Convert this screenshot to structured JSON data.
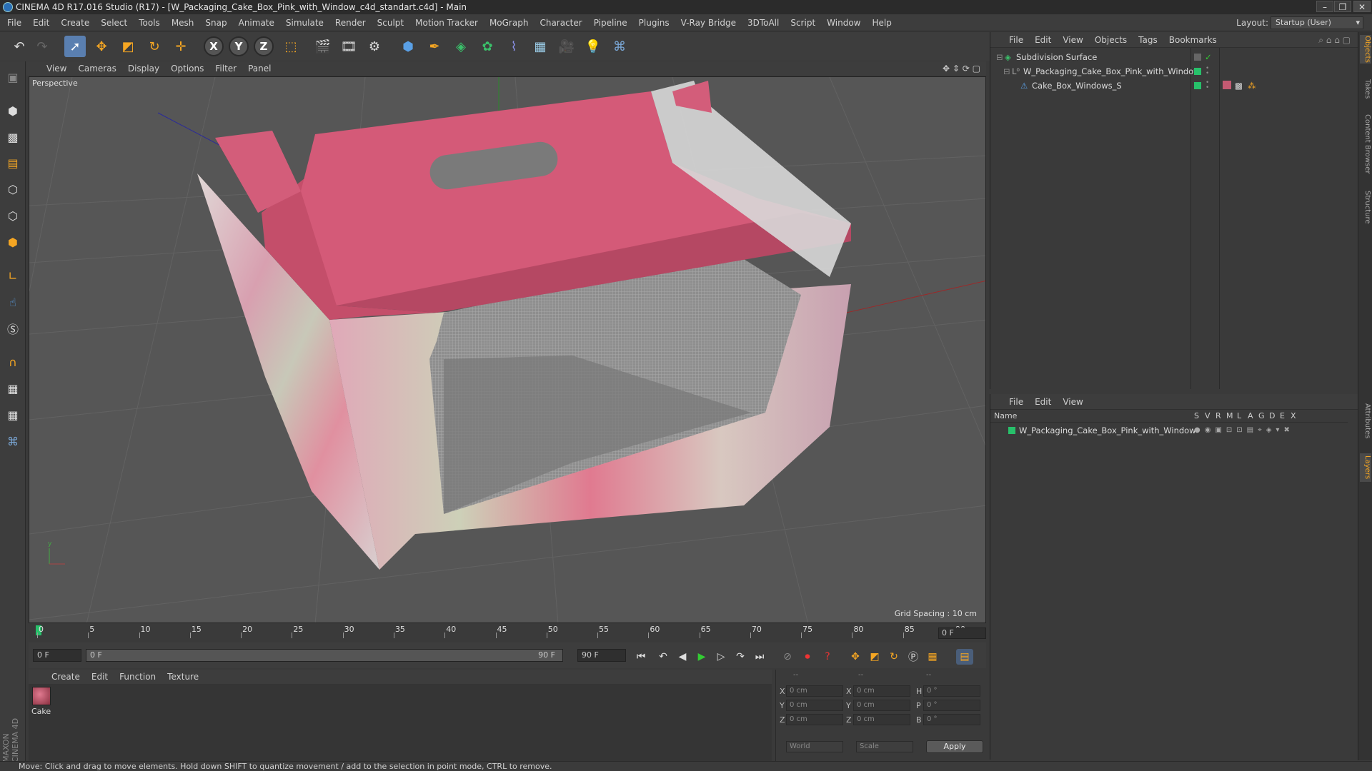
{
  "window": {
    "title": "CINEMA 4D R17.016 Studio (R17) - [W_Packaging_Cake_Box_Pink_with_Window_c4d_standart.c4d] - Main",
    "buttons": [
      "–",
      "❐",
      "✕"
    ]
  },
  "menubar": {
    "items": [
      "File",
      "Edit",
      "Create",
      "Select",
      "Tools",
      "Mesh",
      "Snap",
      "Animate",
      "Simulate",
      "Render",
      "Sculpt",
      "Motion Tracker",
      "MoGraph",
      "Character",
      "Pipeline",
      "Plugins",
      "V-Ray Bridge",
      "3DToAll",
      "Script",
      "Window",
      "Help"
    ],
    "layout_label": "Layout:",
    "layout_value": "Startup (User)"
  },
  "toolbar": {
    "axis_x": "X",
    "axis_y": "Y",
    "axis_z": "Z"
  },
  "viewport": {
    "menu": [
      "View",
      "Cameras",
      "Display",
      "Options",
      "Filter",
      "Panel"
    ],
    "label": "Perspective",
    "grid_spacing": "Grid Spacing : 10 cm",
    "colors": {
      "box_pink": "#c4526d",
      "box_lid": "#d45a78",
      "background": "#565656"
    }
  },
  "timeline": {
    "ticks": [
      "0",
      "5",
      "10",
      "15",
      "20",
      "25",
      "30",
      "35",
      "40",
      "45",
      "50",
      "55",
      "60",
      "65",
      "70",
      "75",
      "80",
      "85",
      "90"
    ],
    "current_frame": "0 F",
    "start_field": "0 F",
    "range_start": "0 F",
    "range_end": "90 F",
    "end_field": "90 F"
  },
  "material_manager": {
    "menu": [
      "Create",
      "Edit",
      "Function",
      "Texture"
    ],
    "material_name": "Cake"
  },
  "coordinates": {
    "header": [
      "--",
      "--",
      "--"
    ],
    "rows": [
      {
        "a": "X",
        "av": "0 cm",
        "b": "X",
        "bv": "0 cm",
        "c": "H",
        "cv": "0 °"
      },
      {
        "a": "Y",
        "av": "0 cm",
        "b": "Y",
        "bv": "0 cm",
        "c": "P",
        "cv": "0 °"
      },
      {
        "a": "Z",
        "av": "0 cm",
        "b": "Z",
        "bv": "0 cm",
        "c": "B",
        "cv": "0 °"
      }
    ],
    "mode_select": "World",
    "type_select": "Scale",
    "apply_label": "Apply"
  },
  "object_manager": {
    "menu": [
      "File",
      "Edit",
      "View",
      "Objects",
      "Tags",
      "Bookmarks"
    ],
    "objects": [
      {
        "name": "Subdivision Surface"
      },
      {
        "name": "W_Packaging_Cake_Box_Pink_with_Window"
      },
      {
        "name": "Cake_Box_Windows_S"
      }
    ]
  },
  "layer_manager": {
    "menu": [
      "File",
      "Edit",
      "View"
    ],
    "columns": [
      "Name",
      "S",
      "V",
      "R",
      "M",
      "L",
      "A",
      "G",
      "D",
      "E",
      "X"
    ],
    "layers": [
      {
        "name": "W_Packaging_Cake_Box_Pink_with_Window"
      }
    ]
  },
  "right_tabs": [
    "Objects",
    "Takes",
    "Content Browser",
    "Structure",
    "Attributes",
    "Layers"
  ],
  "brand": "MAXON CINEMA 4D",
  "status": "Move: Click and drag to move elements. Hold down SHIFT to quantize movement / add to the selection in point mode, CTRL to remove."
}
